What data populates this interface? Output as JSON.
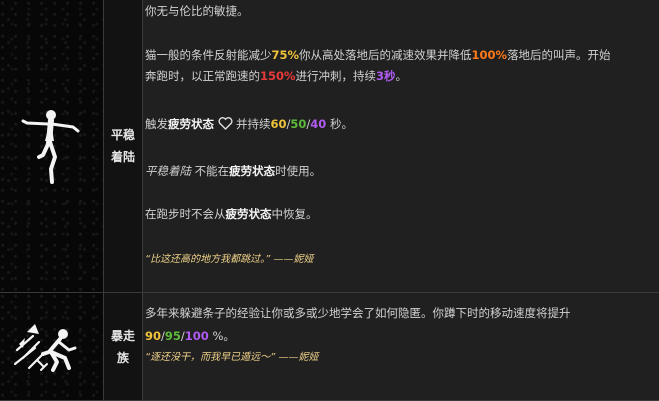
{
  "perks": [
    {
      "name": "平稳着陆",
      "icon": "balanced-landing-icon",
      "intro": "你无与伦比的敏捷。",
      "p1": {
        "a": "猫一般的条件反射能减少",
        "b": "75%",
        "c": "你从高处落地后的减速效果并降低",
        "d": "100%",
        "e": "落地后的叫声。开始"
      },
      "p2": {
        "a": "奔跑时，以正常跑速的",
        "b": "150%",
        "c": "进行冲刺，持续",
        "d": "3秒",
        "e": "。"
      },
      "p3": {
        "a": "触发",
        "b": "疲劳状态",
        "c": "并持续",
        "d": "60",
        "s1": "/",
        "e": "50",
        "s2": "/",
        "f": "40",
        "g": " 秒。"
      },
      "p4": {
        "a": "平稳着陆",
        "b": " 不能在",
        "c": "疲劳状态",
        "d": "时使用。"
      },
      "p5": {
        "a": "在跑步时不会从",
        "b": "疲劳状态",
        "c": "中恢复。"
      },
      "quote": "“比这还高的地方我都跳过。” ——妮娅"
    },
    {
      "name": "暴走族",
      "icon": "urban-evasion-icon",
      "p1": "多年来躲避条子的经验让你或多或少地学会了如何隐匿。你蹲下时的移动速度将提升",
      "p2": {
        "a": "90",
        "s1": "/",
        "b": "95",
        "s2": "/",
        "c": "100",
        "d": " %。"
      },
      "quote": "“逐还没干，而我早已遁远～” ——妮娅"
    }
  ],
  "colors": {
    "tier1": "#f0c43a",
    "tier2": "#5dba3a",
    "tier3": "#b05cf0",
    "orange": "#ff7a1a",
    "red": "#e83a3a"
  }
}
